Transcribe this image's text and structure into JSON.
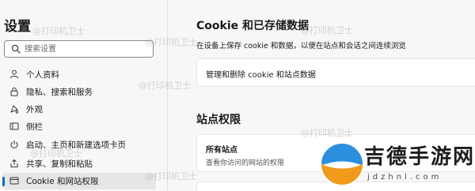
{
  "sidebar": {
    "title": "设置",
    "search_placeholder": "搜索设置",
    "items": [
      {
        "label": "个人资料",
        "icon": "user-icon"
      },
      {
        "label": "隐私、搜索和服务",
        "icon": "lock-icon"
      },
      {
        "label": "外观",
        "icon": "appearance-icon"
      },
      {
        "label": "侧栏",
        "icon": "sidebar-icon"
      },
      {
        "label": "启动、主页和新建选项卡页",
        "icon": "power-icon"
      },
      {
        "label": "共享、复制和粘贴",
        "icon": "share-icon"
      },
      {
        "label": "Cookie 和网站权限",
        "icon": "cookie-icon",
        "active": true
      }
    ]
  },
  "main": {
    "cookie_title": "Cookie 和已存储数据",
    "cookie_desc": "在设备上保存 cookie 和数据，以便在站点和会话之间连续浏览",
    "manage_label": "管理和删除 cookie 和站点数据",
    "site_title": "站点权限",
    "all_sites_title": "所有站点",
    "all_sites_desc": "查看你访问的网站的权限"
  },
  "watermark": "@打印机卫士",
  "logo": {
    "text": "吉德手游网",
    "sub": "jdzhnl.com"
  },
  "colors": {
    "accent": "#0f6cbd",
    "background": "#f7f7f7",
    "card": "#ffffff"
  }
}
